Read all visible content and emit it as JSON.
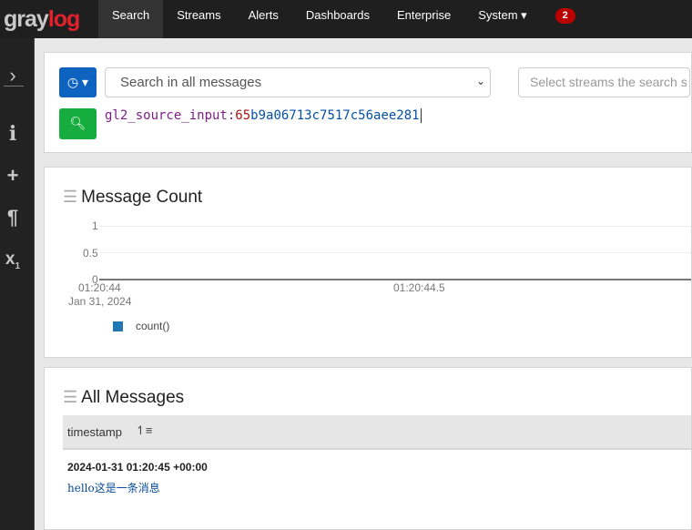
{
  "nav": {
    "logo": "graylog",
    "items": [
      "Search",
      "Streams",
      "Alerts",
      "Dashboards",
      "Enterprise",
      "System ▾"
    ],
    "notifications": "2"
  },
  "sidebar": {
    "icons": [
      "chevron-right-icon",
      "info-icon",
      "plus-icon",
      "paragraph-icon",
      "subscript-icon"
    ]
  },
  "search": {
    "placeholder": "Search in all messages",
    "streams_placeholder": "Select streams the search s",
    "query_field": "gl2_source_input:",
    "query_value_a": "65",
    "query_value_b": "b9a06713c7517c56aee281"
  },
  "chart": {
    "title": "Message Count"
  },
  "chart_data": {
    "type": "line",
    "title": "Message Count",
    "yticks": [
      "1",
      "0.5",
      "0"
    ],
    "ylim": [
      0,
      1
    ],
    "xticks": [
      "01:20:44",
      "01:20:44.5"
    ],
    "xdate": "Jan 31, 2024",
    "series": [
      {
        "name": "count()",
        "color": "#1f77b4"
      }
    ],
    "legend": "bottom-left"
  },
  "messages": {
    "title": "All Messages",
    "column": "timestamp",
    "rows": [
      {
        "timestamp": "2024-01-31 01:20:45 +00:00",
        "message": "hello这是一条消息"
      }
    ]
  }
}
